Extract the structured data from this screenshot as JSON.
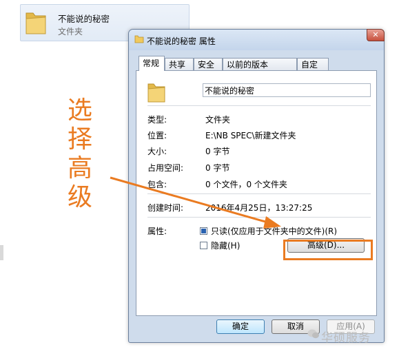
{
  "explorer": {
    "folder_name": "不能说的秘密",
    "folder_type": "文件夹",
    "icon": "folder-icon"
  },
  "dialog": {
    "title": "不能说的秘密 属性",
    "close_label": "✕",
    "tabs": [
      "常规",
      "共享",
      "安全",
      "以前的版本",
      "自定义"
    ],
    "active_tab": "常规",
    "name_value": "不能说的秘密",
    "fields": [
      {
        "label": "类型:",
        "value": "文件夹"
      },
      {
        "label": "位置:",
        "value": "E:\\NB SPEC\\新建文件夹"
      },
      {
        "label": "大小:",
        "value": "0 字节"
      },
      {
        "label": "占用空间:",
        "value": "0 字节"
      },
      {
        "label": "包含:",
        "value": "0 个文件，0 个文件夹"
      }
    ],
    "created_label": "创建时间:",
    "created_value": "2016年4月25日，13:27:25",
    "attributes_label": "属性:",
    "readonly_label": "只读(仅应用于文件夹中的文件)(R)",
    "readonly_checked": true,
    "hidden_label": "隐藏(H)",
    "hidden_checked": false,
    "advanced_button": "高级(D)...",
    "ok_button": "确定",
    "cancel_button": "取消",
    "apply_button": "应用(A)"
  },
  "annotation": {
    "text": "选择高级",
    "color": "#ea7b21"
  },
  "watermark": {
    "text": "华硕服务"
  }
}
